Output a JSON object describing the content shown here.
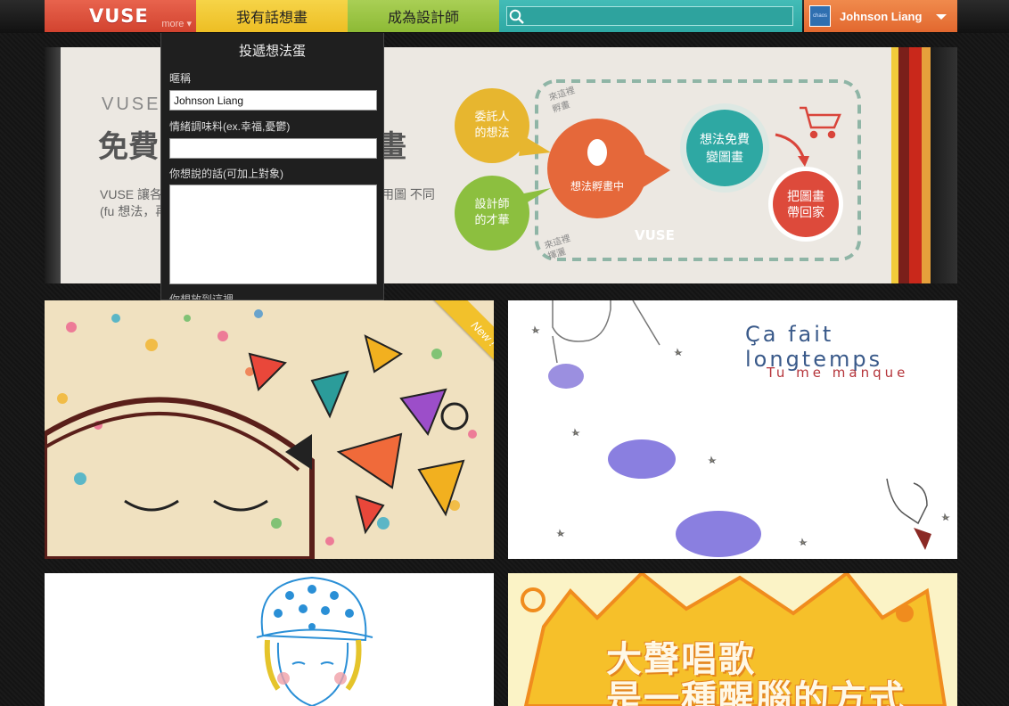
{
  "nav": {
    "logo": "VUSE",
    "more": "more ▾",
    "tab_idea": "我有話想畫",
    "tab_designer": "成為設計師",
    "search_placeholder": "",
    "user_name": "Johnson Liang",
    "avatar_text": "chaos"
  },
  "panel": {
    "title": "投遞想法蛋",
    "nickname_label": "暱稱",
    "nickname_value": "Johnson Liang",
    "mood_label": "情緒調味料(ex.幸福,憂鬱)",
    "mood_value": "",
    "message_label": "你想說的話(可加上對象)",
    "message_value": "",
    "next_label": "你想放到這裡..."
  },
  "hero": {
    "brand": "VUSE",
    "title_left": "免費",
    "title_right": "畫",
    "desc_left": "VUSE 讓各 畫融合 (fu 想法，再由",
    "desc_right": "用圖 不同",
    "diagram": {
      "node_client": "委託人的想法",
      "node_designer": "設計師的才華",
      "node_center": "想法孵畫中",
      "node_free": "想法免費變圖畫",
      "node_home": "把圖畫帶回家",
      "note_top": "來這裡孵畫",
      "note_bottom": "來這裡揮灑",
      "watermark": "VUSE"
    }
  },
  "tiles": {
    "new_ribbon": "New !",
    "t2_line1": "Ça fait longtemps",
    "t2_line2": "Tu me manque",
    "t4_line1": "大聲唱歌",
    "t4_line2": "是一種醒腦的方式"
  },
  "colors": {
    "logo_red": "#d9503a",
    "tab_yellow": "#f1c834",
    "tab_green": "#99c441",
    "search_teal": "#38b1ac",
    "user_orange": "#e8753a"
  }
}
